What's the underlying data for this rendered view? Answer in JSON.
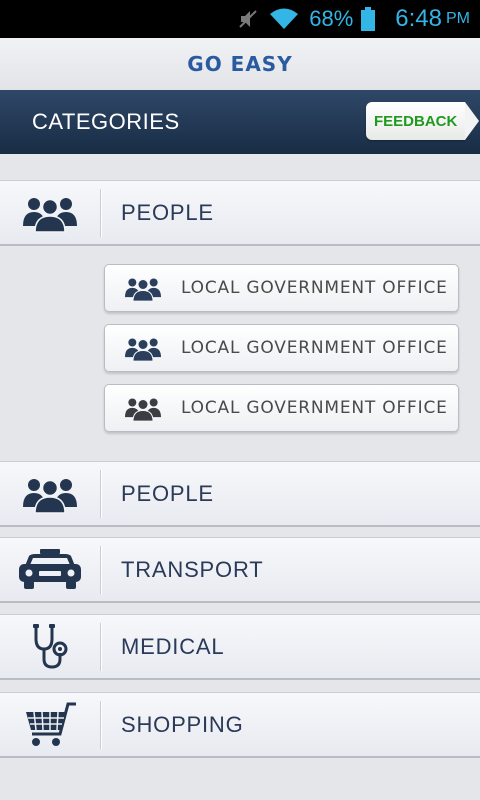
{
  "status_bar": {
    "battery_percent": "68%",
    "time": "6:48",
    "ampm": "PM",
    "icons": [
      "mute-icon",
      "wifi-icon",
      "battery-icon"
    ],
    "color": "#33b5e5"
  },
  "app": {
    "title": "GO EASY"
  },
  "header": {
    "title": "CATEGORIES",
    "feedback_label": "FEEDBACK"
  },
  "categories": [
    {
      "label": "PEOPLE",
      "icon": "people-icon",
      "expanded": true,
      "sub_items": [
        {
          "label": "LOCAL GOVERNMENT OFFICE",
          "icon": "people-icon"
        },
        {
          "label": "LOCAL GOVERNMENT OFFICE",
          "icon": "people-icon"
        },
        {
          "label": "LOCAL GOVERNMENT OFFICE",
          "icon": "people-icon"
        }
      ]
    },
    {
      "label": "PEOPLE",
      "icon": "people-icon"
    },
    {
      "label": "TRANSPORT",
      "icon": "taxi-icon"
    },
    {
      "label": "MEDICAL",
      "icon": "stethoscope-icon"
    },
    {
      "label": "SHOPPING",
      "icon": "shopping-cart-icon"
    }
  ],
  "colors": {
    "header_bg": "#1f3450",
    "brand": "#2a5aa0",
    "feedback_text": "#1f9a1f",
    "label_text": "#2a3a58"
  }
}
